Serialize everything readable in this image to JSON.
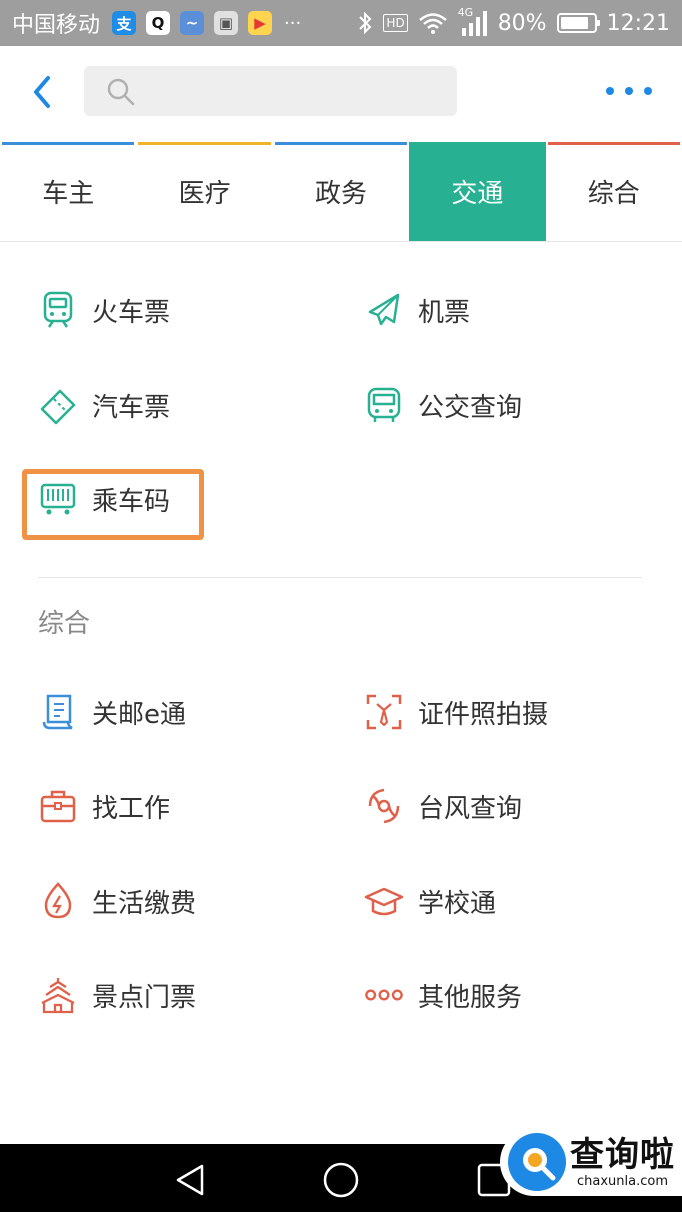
{
  "status_bar": {
    "carrier": "中国移动",
    "apps": [
      "支",
      "Q",
      "~",
      "▣",
      "▶"
    ],
    "more": "···",
    "network": "4G",
    "hd": "HD",
    "battery": "80%",
    "time": "12:21"
  },
  "header": {
    "search_placeholder": ""
  },
  "tabs": [
    {
      "label": "车主",
      "accent": "#3b8fd9"
    },
    {
      "label": "医疗",
      "accent": "#f0b429"
    },
    {
      "label": "政务",
      "accent": "#3b8fd9"
    },
    {
      "label": "交通",
      "accent": "#27b091"
    },
    {
      "label": "综合",
      "accent": "#e0614a"
    }
  ],
  "transport": {
    "items": [
      {
        "label": "火车票",
        "icon": "train-icon"
      },
      {
        "label": "机票",
        "icon": "airplane-icon"
      },
      {
        "label": "汽车票",
        "icon": "bus-ticket-icon"
      },
      {
        "label": "公交查询",
        "icon": "bus-icon"
      },
      {
        "label": "乘车码",
        "icon": "ride-code-icon"
      }
    ]
  },
  "general": {
    "title": "综合",
    "items": [
      {
        "label": "关邮e通",
        "icon": "scroll-icon"
      },
      {
        "label": "证件照拍摄",
        "icon": "id-photo-icon"
      },
      {
        "label": "找工作",
        "icon": "briefcase-icon"
      },
      {
        "label": "台风查询",
        "icon": "typhoon-icon"
      },
      {
        "label": "生活缴费",
        "icon": "payment-icon"
      },
      {
        "label": "学校通",
        "icon": "graduation-cap-icon"
      },
      {
        "label": "景点门票",
        "icon": "temple-icon"
      },
      {
        "label": "其他服务",
        "icon": "more-services-icon"
      }
    ]
  },
  "colors": {
    "accent_teal": "#27b091",
    "accent_blue": "#1e88e5",
    "highlight_orange": "#f09245",
    "icon_red": "#e0614a"
  },
  "watermark": {
    "cn": "查询啦",
    "en": "chaxunla.com"
  }
}
